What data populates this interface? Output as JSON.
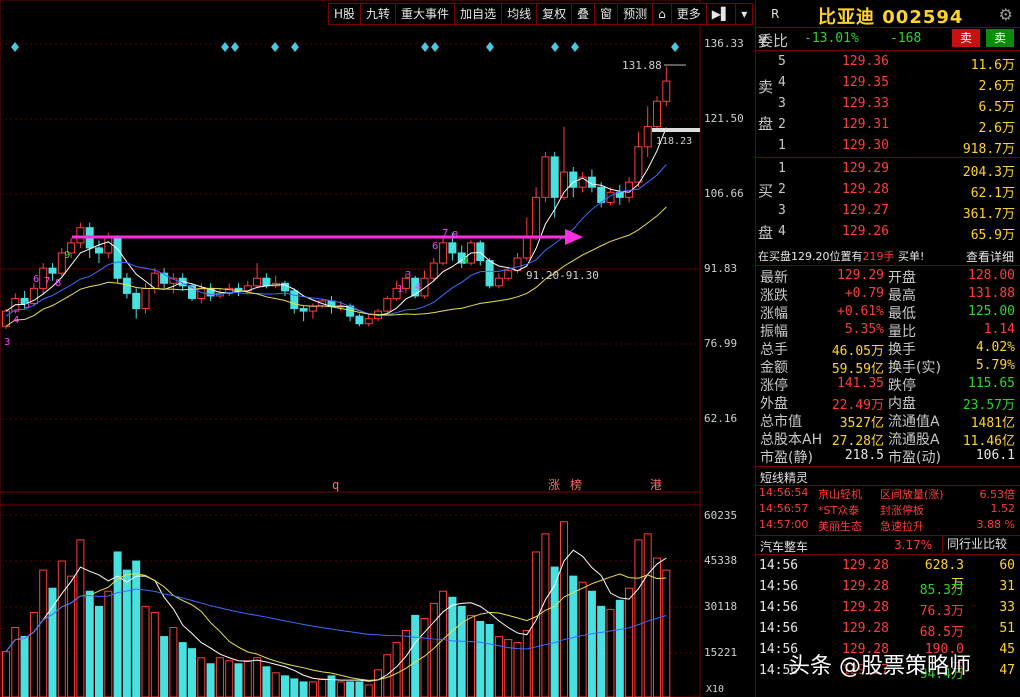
{
  "toolbar": {
    "items": [
      "H股",
      "九转",
      "重大事件",
      "加自选",
      "均线",
      "复权",
      "叠",
      "窗",
      "预测",
      "⌂",
      "更多",
      "▶▌",
      "▾"
    ]
  },
  "axis": {
    "price_labels": [
      "136.33",
      "121.50",
      "106.66",
      "91.83",
      "76.99",
      "62.16"
    ],
    "volume_labels": [
      "60235",
      "45338",
      "30118",
      "15221"
    ],
    "volume_unit": "X10"
  },
  "annotations": {
    "high": "131.88",
    "mid": "118.23",
    "support": "91.20-91.30",
    "bottom_marks": [
      "q",
      "涨",
      "榜",
      "港"
    ]
  },
  "chart_data": {
    "type": "candlestick",
    "ylim": [
      62.16,
      136.33
    ],
    "candles": [
      [
        80.5,
        83.5,
        80,
        84
      ],
      [
        83.5,
        86,
        83,
        87
      ],
      [
        86,
        85,
        84,
        87.5
      ],
      [
        85,
        88,
        84.5,
        89
      ],
      [
        88,
        92,
        87,
        93
      ],
      [
        92,
        91,
        89.5,
        93
      ],
      [
        91,
        95,
        90.5,
        96
      ],
      [
        95,
        97,
        94,
        98
      ],
      [
        97,
        100,
        96,
        101
      ],
      [
        100,
        96,
        94,
        101
      ],
      [
        96,
        95,
        93,
        97.5
      ],
      [
        95,
        98,
        94,
        99
      ],
      [
        98,
        90,
        89,
        98.5
      ],
      [
        90,
        87,
        86,
        91
      ],
      [
        87,
        84,
        82,
        88
      ],
      [
        84,
        88,
        83,
        89
      ],
      [
        88,
        91,
        87,
        92
      ],
      [
        91,
        89,
        88,
        92
      ],
      [
        89,
        90,
        87,
        91
      ],
      [
        90,
        88.5,
        87.5,
        91
      ],
      [
        88.5,
        86,
        85.5,
        89
      ],
      [
        86,
        88,
        85,
        89
      ],
      [
        88,
        86.5,
        85.5,
        89
      ],
      [
        86.5,
        87,
        86,
        88
      ],
      [
        87,
        88,
        86.5,
        89
      ],
      [
        88,
        87.5,
        86.5,
        89
      ],
      [
        87.5,
        88.5,
        87,
        89.5
      ],
      [
        88.5,
        90,
        88,
        93
      ],
      [
        90,
        88.5,
        88,
        91
      ],
      [
        88.5,
        89,
        88,
        90.5
      ],
      [
        89,
        87.5,
        86.5,
        89.5
      ],
      [
        87.5,
        84,
        83,
        88
      ],
      [
        84,
        83.5,
        81.5,
        84.5
      ],
      [
        83.5,
        84.5,
        82,
        85
      ],
      [
        84.5,
        85.5,
        84,
        86
      ],
      [
        85.5,
        84.5,
        83,
        86.5
      ],
      [
        84.5,
        84.5,
        83.5,
        85.5
      ],
      [
        84.5,
        82.5,
        81.5,
        85
      ],
      [
        82.5,
        81,
        80.5,
        83
      ],
      [
        81,
        82,
        80.5,
        83
      ],
      [
        82,
        83.5,
        81.5,
        84
      ],
      [
        83.5,
        86,
        83,
        86.5
      ],
      [
        86,
        88,
        85.5,
        89.5
      ],
      [
        88,
        90,
        87,
        91
      ],
      [
        90,
        86.5,
        86,
        90.5
      ],
      [
        86.5,
        90,
        86,
        91.5
      ],
      [
        90,
        93,
        89.5,
        94
      ],
      [
        93,
        97,
        92.5,
        98
      ],
      [
        97,
        95,
        93.5,
        99
      ],
      [
        95,
        93,
        92,
        96.5
      ],
      [
        93,
        97,
        92.5,
        97.5
      ],
      [
        97,
        93.5,
        92.5,
        97.5
      ],
      [
        93.5,
        88.5,
        88,
        94
      ],
      [
        88.5,
        90,
        88,
        91
      ],
      [
        90,
        91.5,
        89.5,
        92
      ],
      [
        91.5,
        94,
        91,
        95
      ],
      [
        94,
        98,
        93.5,
        102
      ],
      [
        98,
        106,
        97.5,
        108
      ],
      [
        106,
        114,
        105,
        115
      ],
      [
        114,
        106,
        102,
        115
      ],
      [
        106,
        111,
        105.5,
        120
      ],
      [
        111,
        108,
        106,
        112
      ],
      [
        108,
        110,
        107,
        111
      ],
      [
        110,
        108,
        107,
        111.5
      ],
      [
        108,
        105,
        104,
        109
      ],
      [
        105,
        107,
        104.5,
        108
      ],
      [
        107,
        106,
        104.5,
        108.5
      ],
      [
        106,
        109,
        105,
        110
      ],
      [
        109,
        116,
        108,
        119
      ],
      [
        116,
        120,
        114,
        124
      ],
      [
        120,
        125,
        119,
        126
      ],
      [
        125,
        129,
        124,
        131.88
      ]
    ],
    "volumes": [
      15,
      23,
      20,
      28,
      42,
      36,
      45,
      40,
      52,
      35,
      30,
      35,
      48,
      42,
      45,
      30,
      28,
      20,
      23,
      18,
      16,
      13,
      11,
      13,
      12,
      11,
      12,
      13,
      10,
      8,
      7,
      6,
      5,
      5,
      6,
      7,
      5,
      5,
      5,
      4,
      9,
      14,
      18,
      22,
      27,
      26,
      31,
      35,
      33,
      30,
      27,
      25,
      24,
      20,
      19,
      18,
      22,
      48,
      54,
      43,
      58,
      40,
      38,
      35,
      30,
      29,
      32,
      36,
      52,
      54,
      46,
      42
    ]
  },
  "quote": {
    "r_letter": "R",
    "name": "比亚迪",
    "code": "002594",
    "weibi_label": "委比",
    "weibi_value": "-13.01%",
    "weicha_value": "-168",
    "sell_btn": "卖",
    "buy_btn": "卖",
    "sell_side_chars": [
      "¥",
      "卖",
      "盘"
    ],
    "buy_side_chars": [
      "买",
      "盘"
    ],
    "asks": [
      {
        "lvl": "5",
        "price": "129.36",
        "vol": "11.6万"
      },
      {
        "lvl": "4",
        "price": "129.35",
        "vol": "2.6万"
      },
      {
        "lvl": "3",
        "price": "129.33",
        "vol": "6.5万"
      },
      {
        "lvl": "2",
        "price": "129.31",
        "vol": "2.6万"
      },
      {
        "lvl": "1",
        "price": "129.30",
        "vol": "918.7万"
      }
    ],
    "bids": [
      {
        "lvl": "1",
        "price": "129.29",
        "vol": "204.3万"
      },
      {
        "lvl": "2",
        "price": "129.28",
        "vol": "62.1万"
      },
      {
        "lvl": "3",
        "price": "129.27",
        "vol": "361.7万"
      },
      {
        "lvl": "4",
        "price": "129.26",
        "vol": "65.9万"
      }
    ],
    "notice_prefix": "在买盘129.20位置有",
    "notice_amount": "219手",
    "notice_suffix": " 买单!",
    "notice_link": "查看详细",
    "stats": [
      {
        "l": "最新",
        "lv": "129.29",
        "lc": "red",
        "r": "开盘",
        "rv": "128.00",
        "rc": "red"
      },
      {
        "l": "涨跌",
        "lv": "+0.79",
        "lc": "red",
        "r": "最高",
        "rv": "131.88",
        "rc": "red"
      },
      {
        "l": "涨幅",
        "lv": "+0.61%",
        "lc": "red",
        "r": "最低",
        "rv": "125.00",
        "rc": "green"
      },
      {
        "l": "振幅",
        "lv": "5.35%",
        "lc": "red",
        "r": "量比",
        "rv": "1.14",
        "rc": "red"
      },
      {
        "l": "总手",
        "lv": "46.05万",
        "lc": "yellow",
        "r": "换手",
        "rv": "4.02%",
        "rc": "yellow"
      },
      {
        "l": "金额",
        "lv": "59.59亿",
        "lc": "yellow",
        "r": "换手(实)",
        "rv": "5.79%",
        "rc": "yellow"
      },
      {
        "l": "涨停",
        "lv": "141.35",
        "lc": "red",
        "r": "跌停",
        "rv": "115.65",
        "rc": "green"
      },
      {
        "l": "外盘",
        "lv": "22.49万",
        "lc": "red",
        "r": "内盘",
        "rv": "23.57万",
        "rc": "green"
      },
      {
        "l": "总市值",
        "lv": "3527亿",
        "lc": "yellow",
        "r": "流通值A",
        "rv": "1481亿",
        "rc": "yellow"
      },
      {
        "l": "总股本AH",
        "lv": "27.28亿",
        "lc": "yellow",
        "r": "流通股A",
        "rv": "11.46亿",
        "rc": "yellow"
      },
      {
        "l": "市盈(静)",
        "lv": "218.5",
        "lc": "white",
        "r": "市盈(动)",
        "rv": "106.1",
        "rc": "white"
      }
    ]
  },
  "sprites": {
    "title": "短线精灵",
    "rows": [
      {
        "time": "14:56:54",
        "name": "京山轻机",
        "event": "区间放量(涨)",
        "value": "6.53倍"
      },
      {
        "time": "14:56:57",
        "name": "*ST众泰",
        "event": "封涨停板",
        "value": "1.52"
      },
      {
        "time": "14:57:00",
        "name": "美丽生态",
        "event": "急速拉升",
        "value": "3.88 %"
      }
    ]
  },
  "industry": {
    "name": "汽车整车",
    "change": "3.17%",
    "button": "同行业比较"
  },
  "ticks": [
    {
      "time": "14:56",
      "price": "129.28",
      "vol": "628.3万",
      "vc": "yellow",
      "n": "60"
    },
    {
      "time": "14:56",
      "price": "129.28",
      "vol": "85.3万",
      "vc": "green",
      "n": "31"
    },
    {
      "time": "14:56",
      "price": "129.28",
      "vol": "76.3万",
      "vc": "red",
      "n": "33"
    },
    {
      "time": "14:56",
      "price": "129.28",
      "vol": "68.5万",
      "vc": "red",
      "n": "51"
    },
    {
      "time": "14:56",
      "price": "129.28",
      "vol": "190.0万",
      "vc": "red",
      "n": "45"
    },
    {
      "time": "14:56",
      "price": "129.27",
      "vol": "94.4万",
      "vc": "green",
      "n": "47"
    }
  ],
  "watermark": "头条 @股票策略师",
  "colors": {
    "up": "#ff3c3c",
    "down": "#49e0e0",
    "ma5": "#ffffff",
    "ma10": "#3c6cff",
    "ma20": "#e8e050",
    "arrow": "#ff2ee0"
  }
}
